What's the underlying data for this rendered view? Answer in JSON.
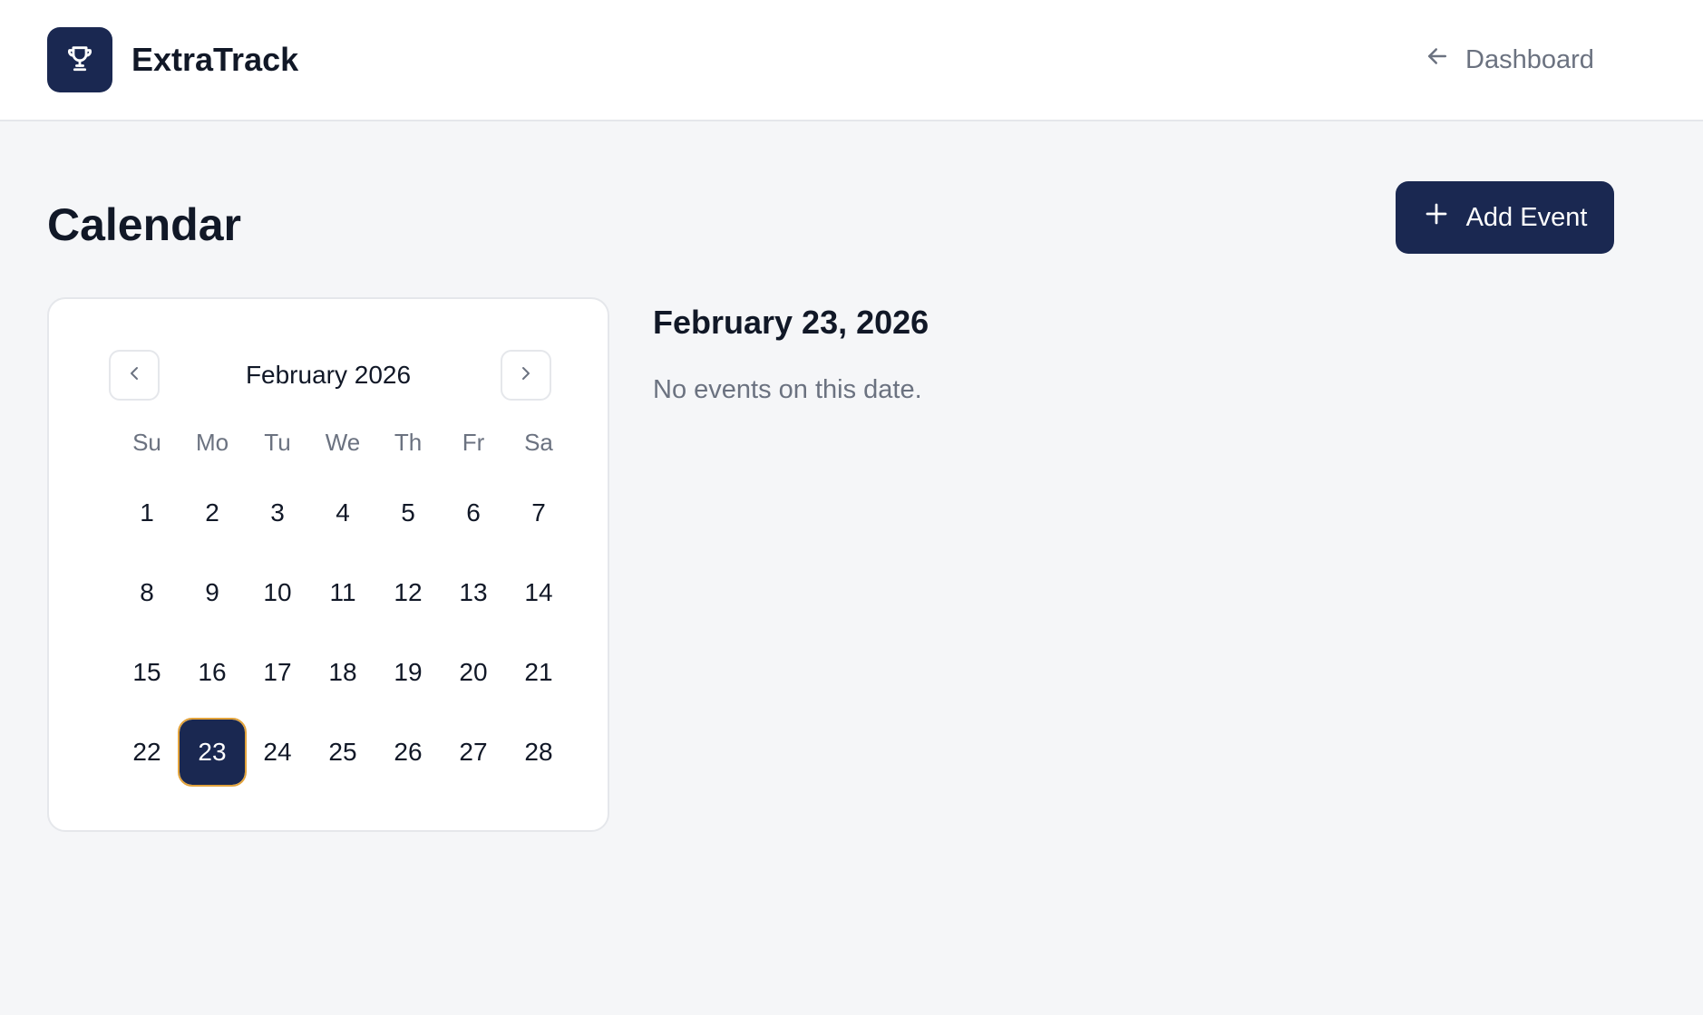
{
  "header": {
    "brand": "ExtraTrack",
    "logo_icon": "trophy-icon",
    "back_link_label": "Dashboard",
    "back_icon": "arrow-left-icon"
  },
  "page": {
    "title": "Calendar",
    "add_event_label": "Add Event",
    "add_icon": "plus-icon"
  },
  "calendar": {
    "month_label": "February 2026",
    "weekdays": [
      "Su",
      "Mo",
      "Tu",
      "We",
      "Th",
      "Fr",
      "Sa"
    ],
    "weeks": [
      [
        "1",
        "2",
        "3",
        "4",
        "5",
        "6",
        "7"
      ],
      [
        "8",
        "9",
        "10",
        "11",
        "12",
        "13",
        "14"
      ],
      [
        "15",
        "16",
        "17",
        "18",
        "19",
        "20",
        "21"
      ],
      [
        "22",
        "23",
        "24",
        "25",
        "26",
        "27",
        "28"
      ]
    ],
    "selected_day": "23",
    "prev_icon": "chevron-left-icon",
    "next_icon": "chevron-right-icon"
  },
  "detail": {
    "date_heading": "February 23, 2026",
    "empty_message": "No events on this date."
  },
  "colors": {
    "primary": "#1a2851",
    "selected_outline": "#e2a33c",
    "page_bg": "#f5f6f8",
    "muted_text": "#6b7280"
  }
}
